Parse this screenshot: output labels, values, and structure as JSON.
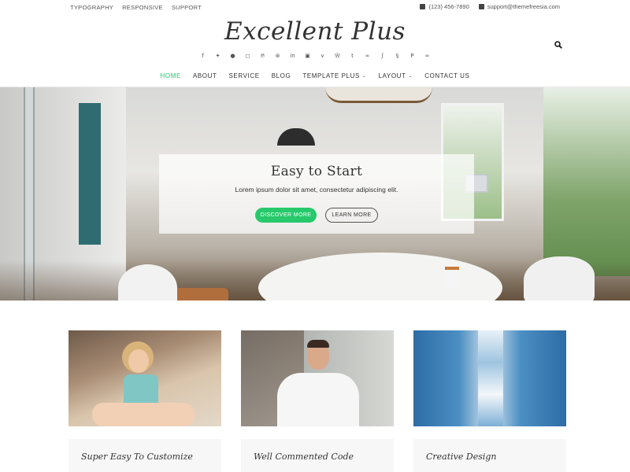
{
  "topbar": {
    "links": [
      "TYPOGRAPHY",
      "RESPONSIVE",
      "SUPPORT"
    ],
    "phone": "(123) 456-7890",
    "email": "support@themefreesia.com"
  },
  "site": {
    "title": "Excellent Plus"
  },
  "social_icons": [
    "facebook-icon",
    "twitter-icon",
    "google-plus-icon",
    "instagram-icon",
    "pinterest-icon",
    "dribbble-icon",
    "linkedin-icon",
    "flickr-icon",
    "vimeo-icon",
    "wordpress-icon",
    "tumblr-icon",
    "tripadvisor-icon",
    "foursquare-icon",
    "skype-icon",
    "paypal-icon",
    "link-icon"
  ],
  "nav": {
    "items": [
      "HOME",
      "ABOUT",
      "SERVICE",
      "BLOG",
      "TEMPLATE PLUS",
      "LAYOUT",
      "CONTACT US"
    ],
    "active": "HOME",
    "dropdowns": [
      "TEMPLATE PLUS",
      "LAYOUT"
    ]
  },
  "hero": {
    "title": "Easy to Start",
    "text": "Lorem ipsum dolor sit amet, consectetur adipiscing elit.",
    "primary_button": "DISCOVER MORE",
    "secondary_button": "LEARN MORE",
    "slides": 2,
    "active_slide": 2
  },
  "features": [
    {
      "title": "Super Easy To Customize"
    },
    {
      "title": "Well Commented Code"
    },
    {
      "title": "Creative Design"
    }
  ],
  "colors": {
    "accent": "#27c96b",
    "text": "#333333"
  }
}
